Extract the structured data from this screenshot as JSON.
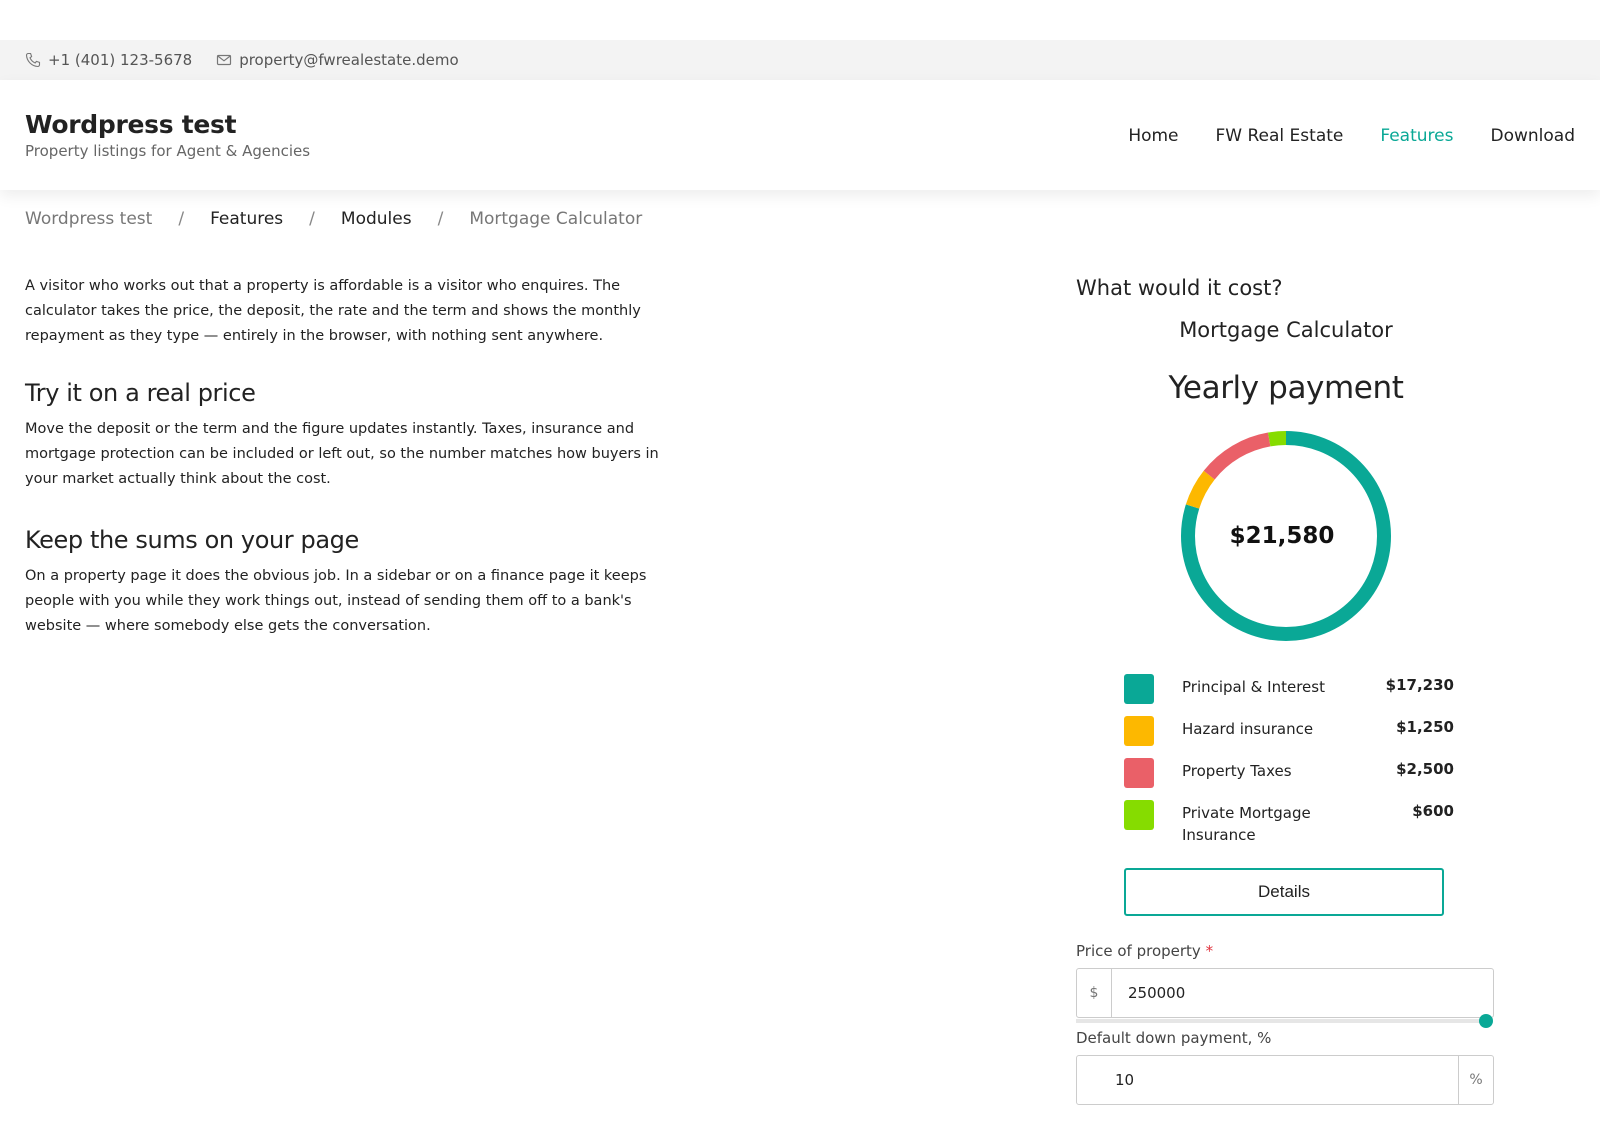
{
  "topbar": {
    "phone": "+1 (401) 123-5678",
    "email": "property@fwrealestate.demo"
  },
  "site": {
    "title": "Wordpress test",
    "tagline": "Property listings for Agent & Agencies"
  },
  "nav": {
    "items": [
      "Home",
      "FW Real Estate",
      "Features",
      "Download"
    ],
    "active": "Features"
  },
  "breadcrumb": {
    "items": [
      "Wordpress test",
      "Features",
      "Modules",
      "Mortgage Calculator"
    ],
    "separator": "/"
  },
  "content": {
    "intro": "A visitor who works out that a property is affordable is a visitor who enquires. The calculator takes the price, the deposit, the rate and the term and shows the monthly repayment as they type — entirely in the browser, with nothing sent anywhere.",
    "sections": [
      {
        "heading": "Try it on a real price",
        "body": "Move the deposit or the term and the figure updates instantly. Taxes, insurance and mortgage protection can be included or left out, so the number matches how buyers in your market actually think about the cost."
      },
      {
        "heading": "Keep the sums on your page",
        "body": "On a property page it does the obvious job. In a sidebar or on a finance page it keeps people with you while they work things out, instead of sending them off to a bank's website — where somebody else gets the conversation."
      }
    ]
  },
  "calculator": {
    "section_heading": "What would it cost?",
    "title": "Mortgage Calculator",
    "period_label": "Yearly payment",
    "total": "$21,580",
    "breakdown": [
      {
        "label": "Principal & Interest",
        "value": "$17,230",
        "amount": 17230,
        "color": "#0aa896"
      },
      {
        "label": "Hazard insurance",
        "value": "$1,250",
        "amount": 1250,
        "color": "#fdb800"
      },
      {
        "label": "Property Taxes",
        "value": "$2,500",
        "amount": 2500,
        "color": "#ea6068"
      },
      {
        "label": "Private Mortgage Insurance",
        "value": "$600",
        "amount": 600,
        "color": "#86dc00"
      }
    ],
    "details_label": "Details",
    "price": {
      "label": "Price of property",
      "required_mark": "*",
      "prefix": "$",
      "value": "250000",
      "slider_fraction": 1.0
    },
    "down_payment": {
      "label": "Default down payment, %",
      "suffix": "%",
      "value": "10"
    }
  },
  "colors": {
    "accent": "#0aa896",
    "required": "#e0313c"
  }
}
